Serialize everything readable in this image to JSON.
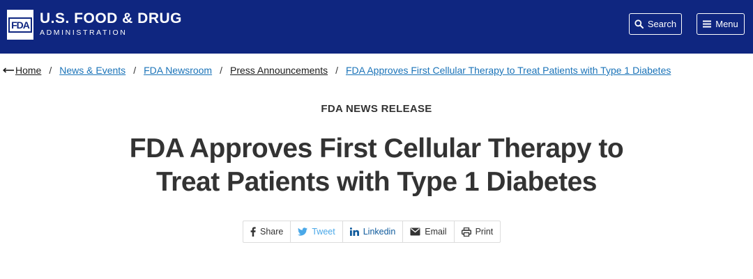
{
  "header": {
    "logo_text": "FDA",
    "agency_name": "U.S. FOOD & DRUG",
    "agency_sub": "ADMINISTRATION",
    "search_label": "Search",
    "menu_label": "Menu",
    "colors": {
      "banner": "#0f2680",
      "text": "#ffffff"
    }
  },
  "breadcrumb": {
    "items": [
      {
        "label": "Home",
        "icon": "left-arrow-icon"
      },
      {
        "label": "News & Events"
      },
      {
        "label": "FDA Newsroom"
      },
      {
        "label": "Press Announcements"
      },
      {
        "label": "FDA Approves First Cellular Therapy to Treat Patients with Type 1 Diabetes"
      }
    ],
    "separator": "/"
  },
  "article": {
    "eyebrow": "FDA NEWS RELEASE",
    "title_line1": "FDA Approves First Cellular Therapy to",
    "title_line2": "Treat Patients with Type 1 Diabetes"
  },
  "share": {
    "items": [
      {
        "label": "Share",
        "icon": "facebook-icon"
      },
      {
        "label": "Tweet",
        "icon": "twitter-icon"
      },
      {
        "label": "Linkedin",
        "icon": "linkedin-icon"
      },
      {
        "label": "Email",
        "icon": "envelope-icon"
      },
      {
        "label": "Print",
        "icon": "printer-icon"
      }
    ],
    "colors": {
      "tweet": "#4aa8e8",
      "linkedin": "#0e5a9c"
    }
  }
}
